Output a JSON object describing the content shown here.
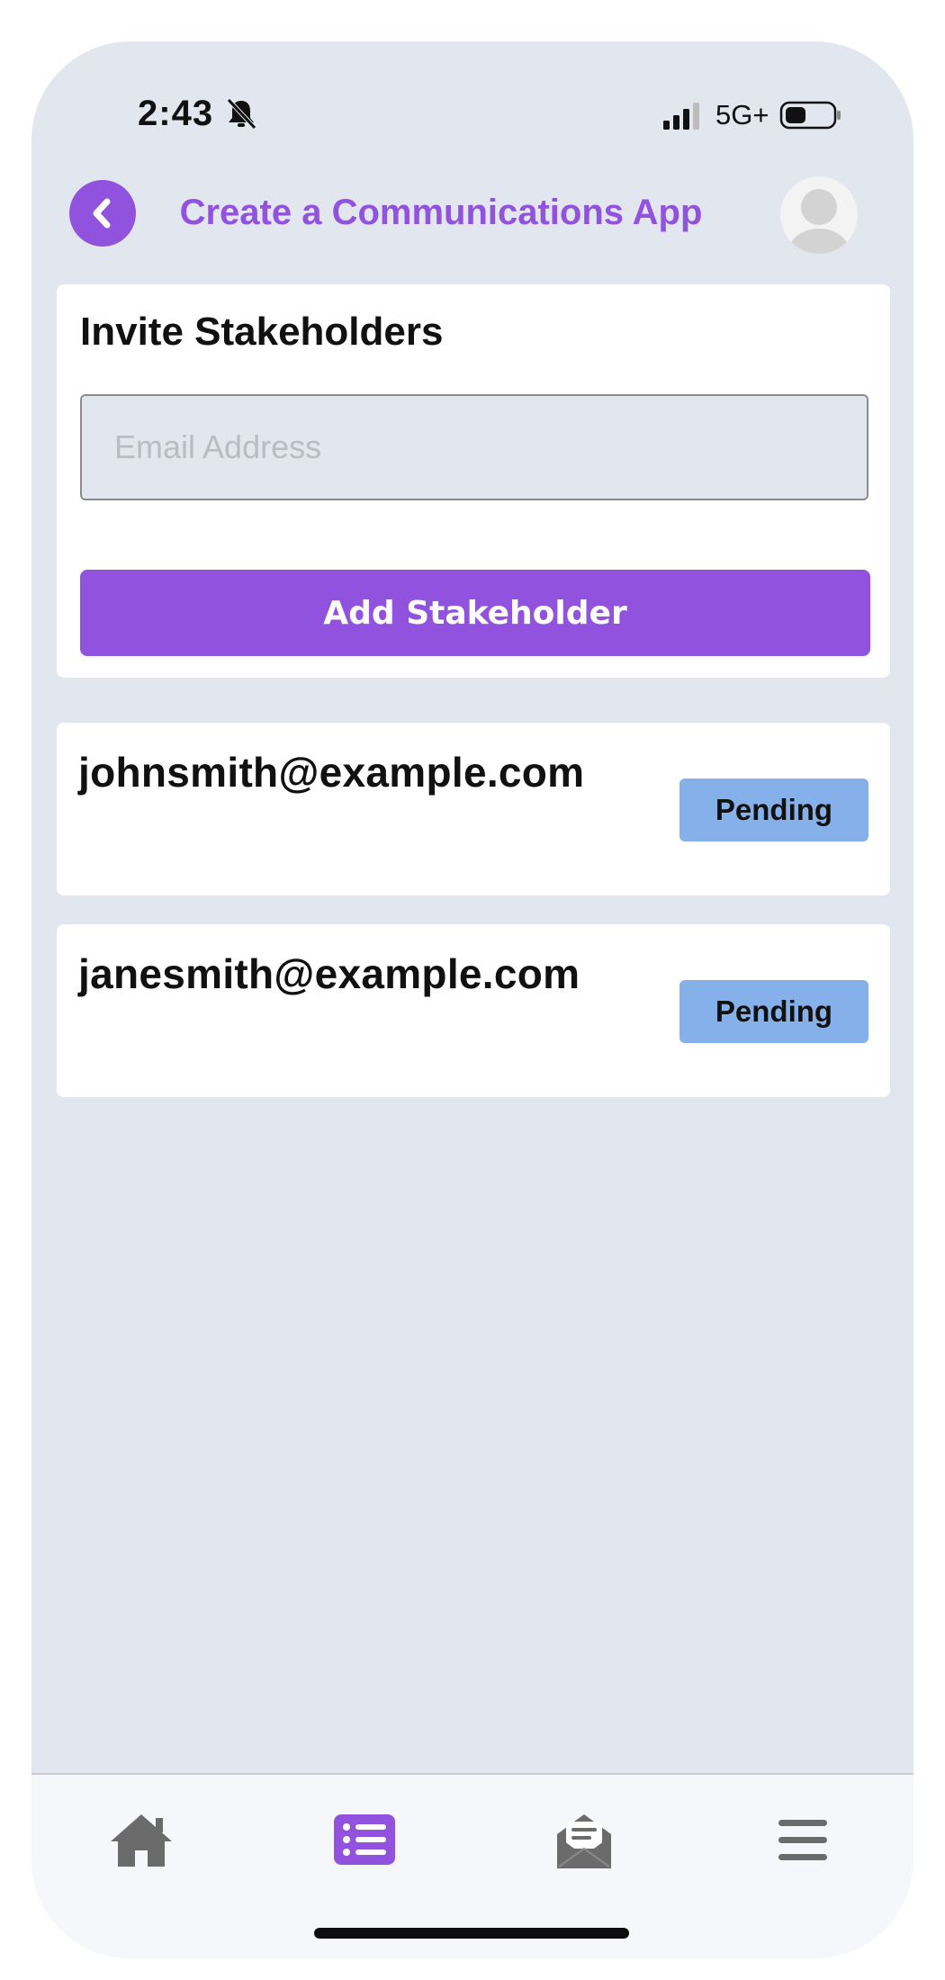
{
  "status_bar": {
    "time": "2:43",
    "network": "5G+",
    "icons": [
      "bell-slash-icon",
      "signal-icon",
      "battery-icon"
    ]
  },
  "header": {
    "title": "Create a Communications App",
    "back_icon": "chevron-left-icon",
    "avatar_icon": "user-avatar-icon"
  },
  "invite": {
    "heading": "Invite Stakeholders",
    "email_placeholder": "Email Address",
    "email_value": "",
    "add_button_label": "Add Stakeholder"
  },
  "stakeholders": [
    {
      "email": "johnsmith@example.com",
      "status": "Pending"
    },
    {
      "email": "janesmith@example.com",
      "status": "Pending"
    }
  ],
  "bottom_nav": {
    "items": [
      {
        "icon": "home-icon",
        "active": false
      },
      {
        "icon": "list-icon",
        "active": true
      },
      {
        "icon": "mail-open-icon",
        "active": false
      },
      {
        "icon": "menu-icon",
        "active": false
      }
    ]
  },
  "colors": {
    "accent": "#9152de",
    "background": "#e1e6ef",
    "badge": "#85b0ea",
    "nav_icon": "#6b6b6b"
  }
}
